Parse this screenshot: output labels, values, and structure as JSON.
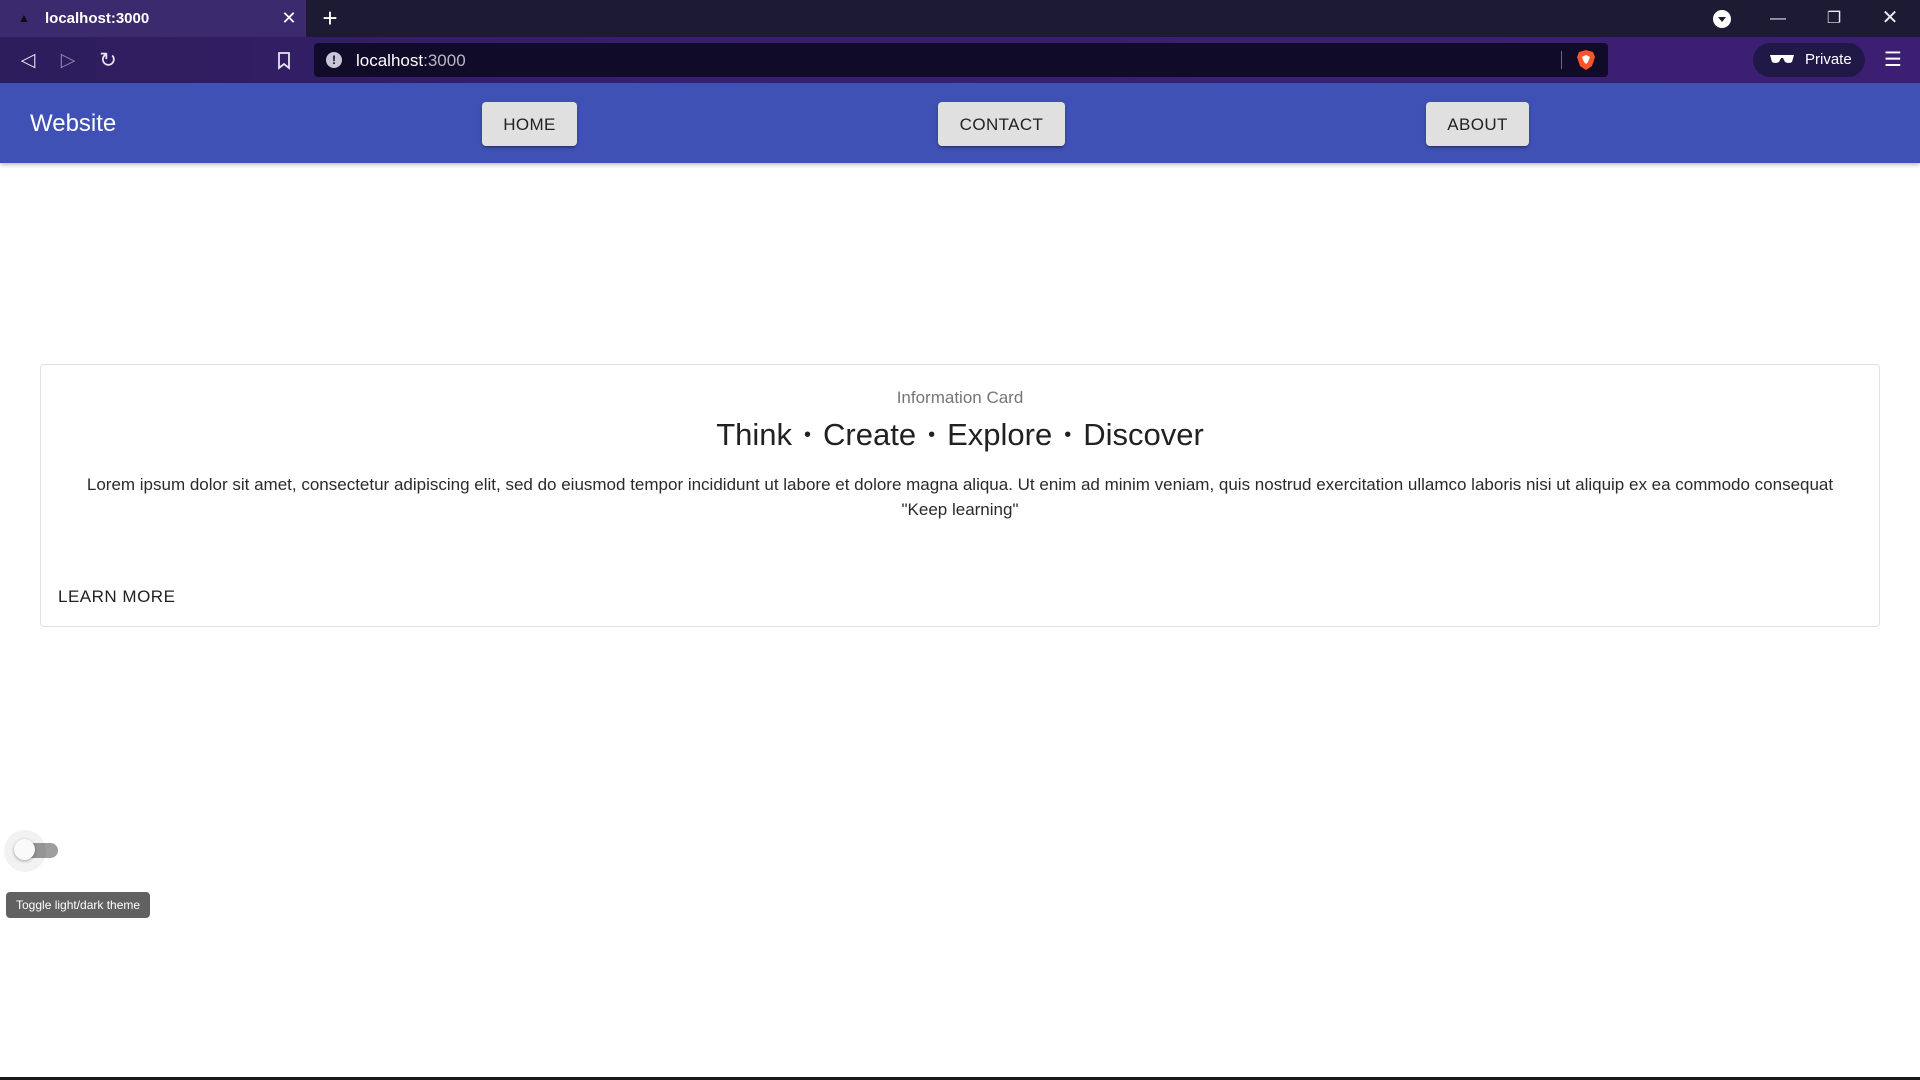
{
  "browser": {
    "tab_title": "localhost:3000",
    "url_host": "localhost",
    "url_port": ":3000",
    "private_label": "Private",
    "icons": {
      "tab_favicon": "leaf-icon",
      "tab_close": "close-icon",
      "new_tab": "plus-icon",
      "back": "back-arrow-icon",
      "forward": "forward-arrow-icon",
      "reload": "reload-icon",
      "bookmark": "bookmark-icon",
      "site_info": "info-icon",
      "shields": "brave-shield-icon",
      "private": "private-glasses-icon",
      "menu": "hamburger-menu-icon",
      "window_menu": "chevron-down-circle-icon",
      "minimize": "minimize-icon",
      "restore": "restore-icon",
      "close_window": "close-icon"
    }
  },
  "appbar": {
    "brand": "Website",
    "nav": [
      "HOME",
      "CONTACT",
      "ABOUT"
    ],
    "color": "#3f51b5"
  },
  "card": {
    "overline": "Information Card",
    "headline": [
      "Think",
      "Create",
      "Explore",
      "Discover"
    ],
    "separator": "•",
    "body": "Lorem ipsum dolor sit amet, consectetur adipiscing elit, sed do eiusmod tempor incididunt ut labore et dolore magna aliqua. Ut enim ad minim veniam, quis nostrud exercitation ullamco laboris nisi ut aliquip ex ea commodo consequat",
    "quote": "\"Keep learning\"",
    "action": "LEARN MORE"
  },
  "theme_switch": {
    "checked": false,
    "tooltip": "Toggle light/dark theme"
  }
}
